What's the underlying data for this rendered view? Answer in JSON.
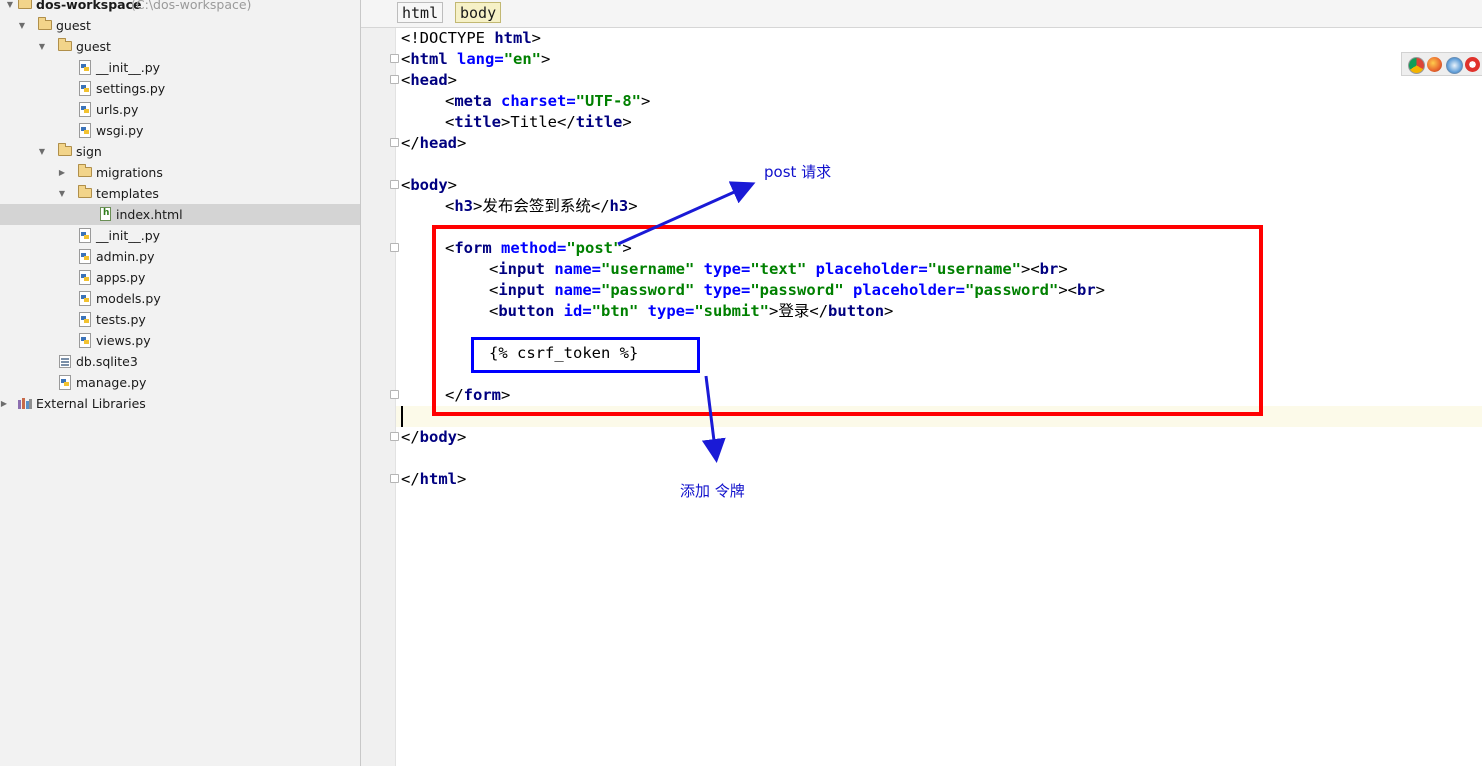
{
  "project_tree": {
    "items": [
      {
        "label": "dos-workspace",
        "hint": "(C:\\dos-workspace)",
        "kind": "folder",
        "depth": 0,
        "expanded": true
      },
      {
        "label": "guest",
        "kind": "folder",
        "depth": 1,
        "expanded": true
      },
      {
        "label": "guest",
        "kind": "folder",
        "depth": 2,
        "expanded": true
      },
      {
        "label": "__init__.py",
        "kind": "python-file",
        "depth": 3
      },
      {
        "label": "settings.py",
        "kind": "python-file",
        "depth": 3
      },
      {
        "label": "urls.py",
        "kind": "python-file",
        "depth": 3
      },
      {
        "label": "wsgi.py",
        "kind": "python-file",
        "depth": 3
      },
      {
        "label": "sign",
        "kind": "folder",
        "depth": 2,
        "expanded": true
      },
      {
        "label": "migrations",
        "kind": "folder",
        "depth": 3,
        "expanded": false
      },
      {
        "label": "templates",
        "kind": "folder",
        "depth": 3,
        "expanded": true
      },
      {
        "label": "index.html",
        "kind": "html-file",
        "depth": 4,
        "selected": true
      },
      {
        "label": "__init__.py",
        "kind": "python-file",
        "depth": 3
      },
      {
        "label": "admin.py",
        "kind": "python-file",
        "depth": 3
      },
      {
        "label": "apps.py",
        "kind": "python-file",
        "depth": 3
      },
      {
        "label": "models.py",
        "kind": "python-file",
        "depth": 3
      },
      {
        "label": "tests.py",
        "kind": "python-file",
        "depth": 3
      },
      {
        "label": "views.py",
        "kind": "python-file",
        "depth": 3
      },
      {
        "label": "db.sqlite3",
        "kind": "database-file",
        "depth": 2
      },
      {
        "label": "manage.py",
        "kind": "python-file",
        "depth": 2
      },
      {
        "label": "External Libraries",
        "kind": "library",
        "depth": 0,
        "expanded": false
      }
    ]
  },
  "breadcrumbs": [
    "html",
    "body"
  ],
  "code": {
    "line1": {
      "s1": "<!DOCTYPE ",
      "s2": "html",
      "s3": ">"
    },
    "line2": {
      "s1": "<",
      "s2": "html ",
      "s3": "lang=",
      "s4": "\"en\"",
      "s5": ">"
    },
    "line3": {
      "s1": "<",
      "s2": "head",
      "s3": ">"
    },
    "line4": {
      "s1": "<",
      "s2": "meta ",
      "s3": "charset=",
      "s4": "\"UTF-8\"",
      "s5": ">"
    },
    "line5": {
      "s1": "<",
      "s2": "title",
      "s3": ">",
      "s4": "Title",
      "s5": "</",
      "s6": "title",
      "s7": ">"
    },
    "line6": {
      "s1": "</",
      "s2": "head",
      "s3": ">"
    },
    "line8": {
      "s1": "<",
      "s2": "body",
      "s3": ">"
    },
    "line9": {
      "s1": "<",
      "s2": "h3",
      "s3": ">",
      "s4": "发布会签到系统",
      "s5": "</",
      "s6": "h3",
      "s7": ">"
    },
    "line11": {
      "s1": "<",
      "s2": "form ",
      "s3": "method=",
      "s4": "\"post\"",
      "s5": ">"
    },
    "line12": {
      "s1": "<",
      "s2": "input ",
      "s3": "name=",
      "s4": "\"username\"",
      "s5": " type=",
      "s6": "\"text\"",
      "s7": " placeholder=",
      "s8": "\"username\"",
      "s9": "><",
      "s10": "br",
      "s11": ">"
    },
    "line13": {
      "s1": "<",
      "s2": "input ",
      "s3": "name=",
      "s4": "\"password\"",
      "s5": " type=",
      "s6": "\"password\"",
      "s7": " placeholder=",
      "s8": "\"password\"",
      "s9": "><",
      "s10": "br",
      "s11": ">"
    },
    "line14": {
      "s1": "<",
      "s2": "button ",
      "s3": "id=",
      "s4": "\"btn\"",
      "s5": " type=",
      "s6": "\"submit\"",
      "s7": ">",
      "s8": "登录",
      "s9": "</",
      "s10": "button",
      "s11": ">"
    },
    "line16": {
      "s1": "{% csrf_token %}"
    },
    "line18": {
      "s1": "</",
      "s2": "form",
      "s3": ">"
    },
    "line21": {
      "s1": "</",
      "s2": "body",
      "s3": ">"
    },
    "line23": {
      "s1": "</",
      "s2": "html",
      "s3": ">"
    }
  },
  "annotations": {
    "post_note": "post 请求",
    "csrf_note": "添加 令牌",
    "colors": {
      "red_box": "#ff0000",
      "blue_box": "#0000ff",
      "note_text": "#1111cc"
    }
  },
  "browser_icons": [
    "chrome-icon",
    "firefox-icon",
    "safari-icon",
    "opera-icon"
  ]
}
